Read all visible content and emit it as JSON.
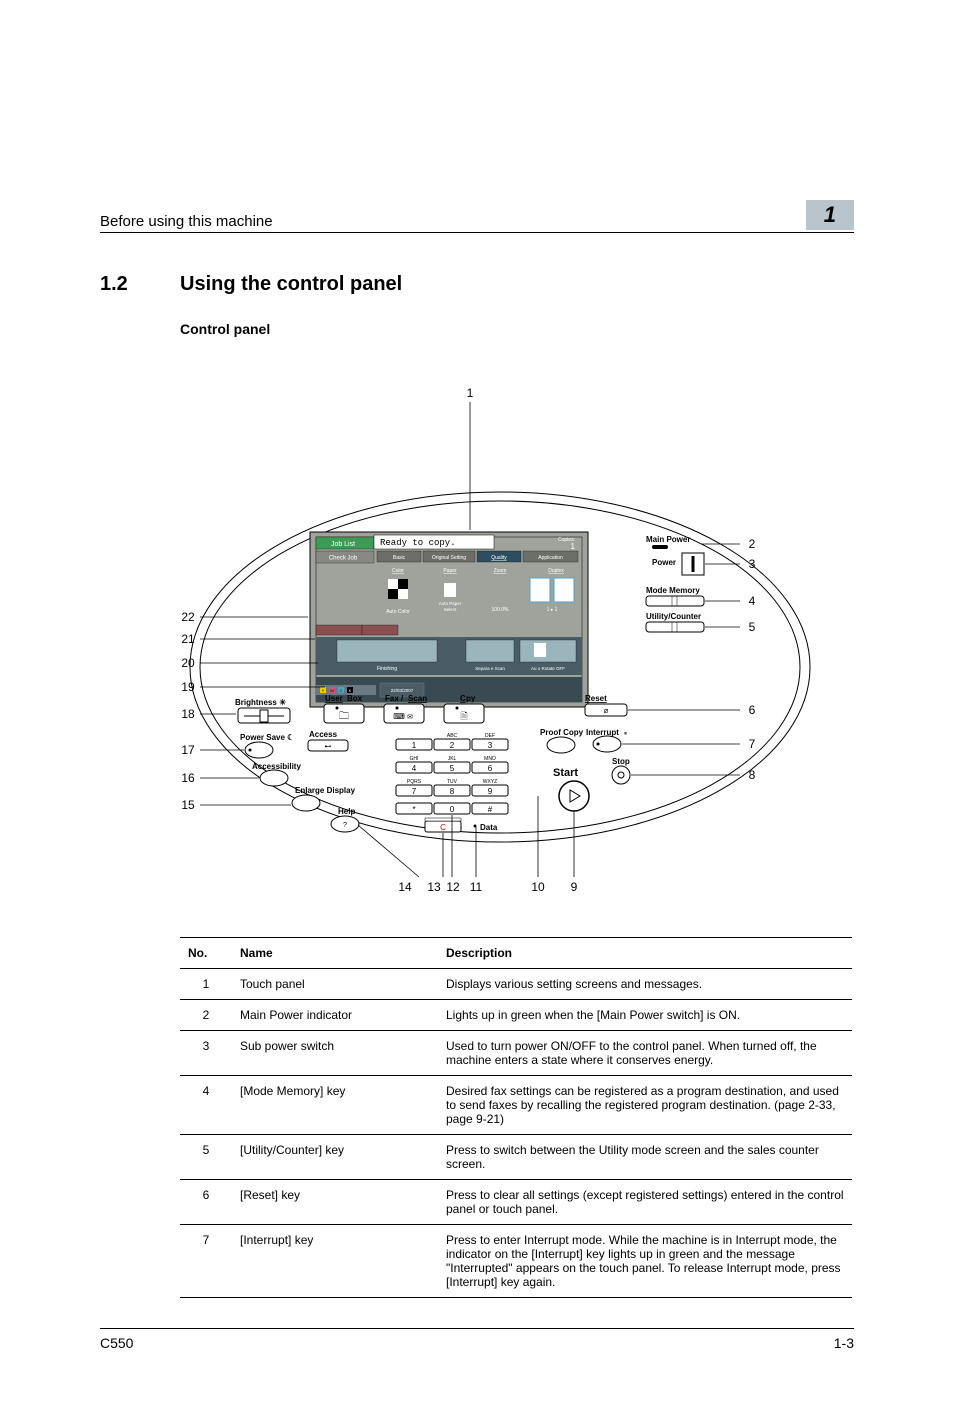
{
  "header": {
    "running_head": "Before using this machine",
    "chapter_number": "1"
  },
  "section": {
    "number": "1.2",
    "title": "Using the control panel",
    "sub": "Control panel"
  },
  "diagram": {
    "callouts": [
      "1",
      "2",
      "3",
      "4",
      "5",
      "6",
      "7",
      "8",
      "9",
      "10",
      "11",
      "12",
      "13",
      "14",
      "15",
      "16",
      "17",
      "18",
      "19",
      "20",
      "21",
      "22"
    ],
    "panel_labels": {
      "main_power": "Main Power",
      "power": "Power",
      "mode_memory": "Mode Memory",
      "utility_counter": "Utility/Counter",
      "reset": "Reset",
      "interrupt": "Interrupt",
      "stop": "Stop",
      "start": "Start",
      "proof_copy": "Proof Copy",
      "access": "Access",
      "accessibility": "Accessibility",
      "enlarge_display": "Enlarge Display",
      "help": "Help",
      "power_save": "Power Save",
      "brightness": "Brightness",
      "user_box": "User Box",
      "fax_scan": "Fax / Scan",
      "copy": "Copy",
      "data": "Data",
      "c": "C",
      "keypad_letters": [
        "",
        "ABC",
        "DEF",
        "GHI",
        "JKL",
        "MNO",
        "PQRS",
        "TUV",
        "WXYZ"
      ],
      "keypad_digits": [
        "1",
        "2",
        "3",
        "4",
        "5",
        "6",
        "7",
        "8",
        "9",
        "*",
        "0",
        "#"
      ],
      "screen_title": "Ready to copy.",
      "screen_tabs": [
        "Job List",
        "Check Job"
      ],
      "screen_top": [
        "Copies:",
        "1"
      ],
      "screen_sections": [
        "Basic",
        "Original Setting",
        "Quality",
        "Application",
        "Color",
        "Paper",
        "Zoom",
        "Duplex"
      ],
      "screen_values": [
        "Auto Color",
        "Auto Paper Select",
        "100.0%",
        "1 1"
      ],
      "screen_bottom": [
        "Finishing",
        "Separa e Scan",
        "Auto Rotate OFF"
      ],
      "toner": [
        "Y",
        "M",
        "C",
        "K"
      ]
    }
  },
  "table": {
    "headers": {
      "no": "No.",
      "name": "Name",
      "desc": "Description"
    },
    "rows": [
      {
        "no": "1",
        "name": "Touch panel",
        "desc": "Displays various setting screens and messages."
      },
      {
        "no": "2",
        "name": "Main Power indicator",
        "desc": "Lights up in green when the [Main Power switch] is ON."
      },
      {
        "no": "3",
        "name": "Sub power switch",
        "desc": "Used to turn power ON/OFF to the control panel. When turned off, the machine enters a state where it conserves energy."
      },
      {
        "no": "4",
        "name": "[Mode Memory] key",
        "desc": "Desired fax settings can be registered as a program destination, and used to send faxes by recalling the registered program destination. (page 2-33, page 9-21)"
      },
      {
        "no": "5",
        "name": "[Utility/Counter] key",
        "desc": "Press to switch between the Utility mode screen and the sales counter screen."
      },
      {
        "no": "6",
        "name": "[Reset] key",
        "desc": "Press to clear all settings (except registered settings) entered in the control panel or touch panel."
      },
      {
        "no": "7",
        "name": "[Interrupt] key",
        "desc": "Press to enter Interrupt mode. While the machine is in Interrupt mode, the indicator on the [Interrupt] key lights up in green and the message \"Interrupted\" appears on the touch panel. To release Interrupt mode, press [Interrupt] key again."
      }
    ]
  },
  "footer": {
    "left": "C550",
    "right": "1-3"
  }
}
